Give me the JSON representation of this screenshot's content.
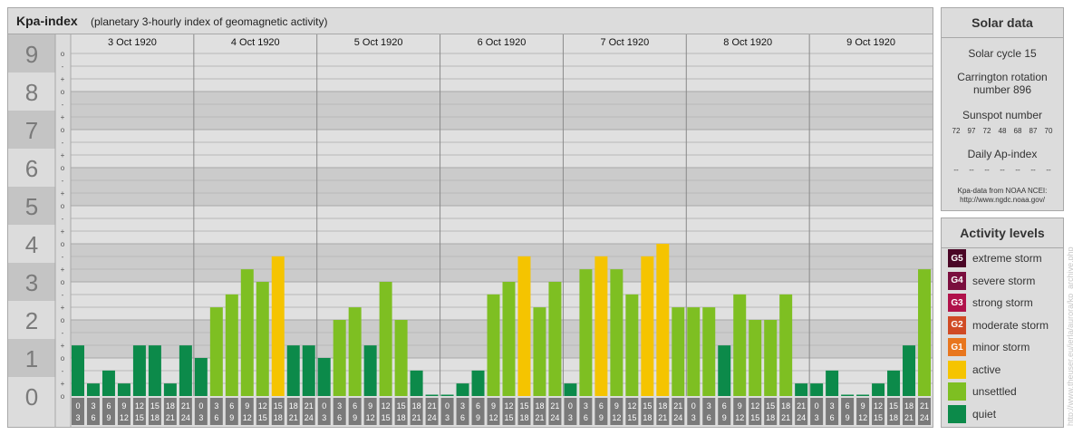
{
  "chart_data": {
    "type": "bar",
    "title": "Kpa-index",
    "subtitle": "(planetary 3-hourly index of geomagnetic activity)",
    "ylim": [
      0,
      9
    ],
    "y_ticks": [
      "0",
      "1",
      "2",
      "3",
      "4",
      "5",
      "6",
      "7",
      "8",
      "9"
    ],
    "minor_ticks": [
      "-",
      "o",
      "+"
    ],
    "days": [
      "3 Oct 1920",
      "4 Oct 1920",
      "5 Oct 1920",
      "6 Oct 1920",
      "7 Oct 1920",
      "8 Oct 1920",
      "9 Oct 1920"
    ],
    "interval_starts": [
      "0",
      "3",
      "6",
      "9",
      "12",
      "15",
      "18",
      "21"
    ],
    "interval_ends": [
      "3",
      "6",
      "9",
      "12",
      "15",
      "18",
      "21",
      "24"
    ],
    "values": [
      1.33,
      0.33,
      0.67,
      0.33,
      1.33,
      1.33,
      0.33,
      1.33,
      1.0,
      2.33,
      2.67,
      3.33,
      3.0,
      3.67,
      1.33,
      1.33,
      1.0,
      2.0,
      2.33,
      1.33,
      3.0,
      2.0,
      0.67,
      0.0,
      0.0,
      0.33,
      0.67,
      2.67,
      3.0,
      3.67,
      2.33,
      3.0,
      0.33,
      3.33,
      3.67,
      3.33,
      2.67,
      3.67,
      4.0,
      2.33,
      2.33,
      2.33,
      1.33,
      2.67,
      2.0,
      2.0,
      2.67,
      0.33,
      0.33,
      0.67,
      0.0,
      0.0,
      0.33,
      0.67,
      1.33,
      3.33
    ],
    "level_colors": {
      "quiet": "#0c8a4a",
      "unsettled": "#7ebf22",
      "active": "#f5c400",
      "minor_storm": "#e8761e",
      "moderate_storm": "#d04a24",
      "strong_storm": "#b0124a",
      "severe_storm": "#7a0e3e",
      "extreme_storm": "#4a0626"
    }
  },
  "solar_data": {
    "title": "Solar data",
    "solar_cycle": "Solar cycle 15",
    "carrington_line1": "Carrington rotation",
    "carrington_line2": "number 896",
    "sunspot_label": "Sunspot number",
    "sunspot_values": [
      "72",
      "97",
      "72",
      "48",
      "68",
      "87",
      "70"
    ],
    "ap_label": "Daily Ap-index",
    "ap_values": [
      "--",
      "--",
      "--",
      "--",
      "--",
      "--",
      "--"
    ],
    "credit_line1": "Kpa-data from NOAA NCEI:",
    "credit_line2": "http://www.ngdc.noaa.gov/"
  },
  "activity_levels": {
    "title": "Activity levels",
    "items": [
      {
        "code": "G5",
        "label": "extreme storm",
        "color": "#4a0626"
      },
      {
        "code": "G4",
        "label": "severe storm",
        "color": "#7a0e3e"
      },
      {
        "code": "G3",
        "label": "strong storm",
        "color": "#b0124a"
      },
      {
        "code": "G2",
        "label": "moderate storm",
        "color": "#d04a24"
      },
      {
        "code": "G1",
        "label": "minor storm",
        "color": "#e8761e"
      },
      {
        "code": "",
        "label": "active",
        "color": "#f5c400"
      },
      {
        "code": "",
        "label": "unsettled",
        "color": "#7ebf22"
      },
      {
        "code": "",
        "label": "quiet",
        "color": "#0c8a4a"
      }
    ]
  },
  "watermark": "http://www.theuser.eu/ierla/aurora/kp_archive.php"
}
